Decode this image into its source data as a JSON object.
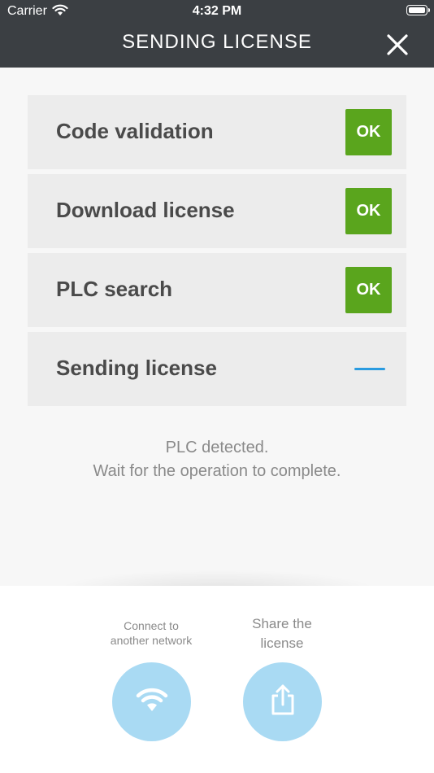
{
  "status_bar": {
    "carrier": "Carrier",
    "time": "4:32 PM"
  },
  "header": {
    "title": "SENDING LICENSE",
    "close_icon": "close-icon"
  },
  "steps": [
    {
      "label": "Code validation",
      "status": "OK"
    },
    {
      "label": "Download license",
      "status": "OK"
    },
    {
      "label": "PLC search",
      "status": "OK"
    },
    {
      "label": "Sending license",
      "status": "in-progress"
    }
  ],
  "message": {
    "line1": "PLC detected.",
    "line2": "Wait for the operation to complete."
  },
  "actions": {
    "connect": {
      "line1": "Connect to",
      "line2": "another network",
      "icon": "wifi-icon"
    },
    "share": {
      "line1": "Share the",
      "line2": "license",
      "icon": "share-icon"
    }
  },
  "colors": {
    "header_bg": "#3b3f43",
    "ok_green": "#5aa51d",
    "progress_blue": "#2a9be0",
    "action_circle": "#a9daf3"
  }
}
